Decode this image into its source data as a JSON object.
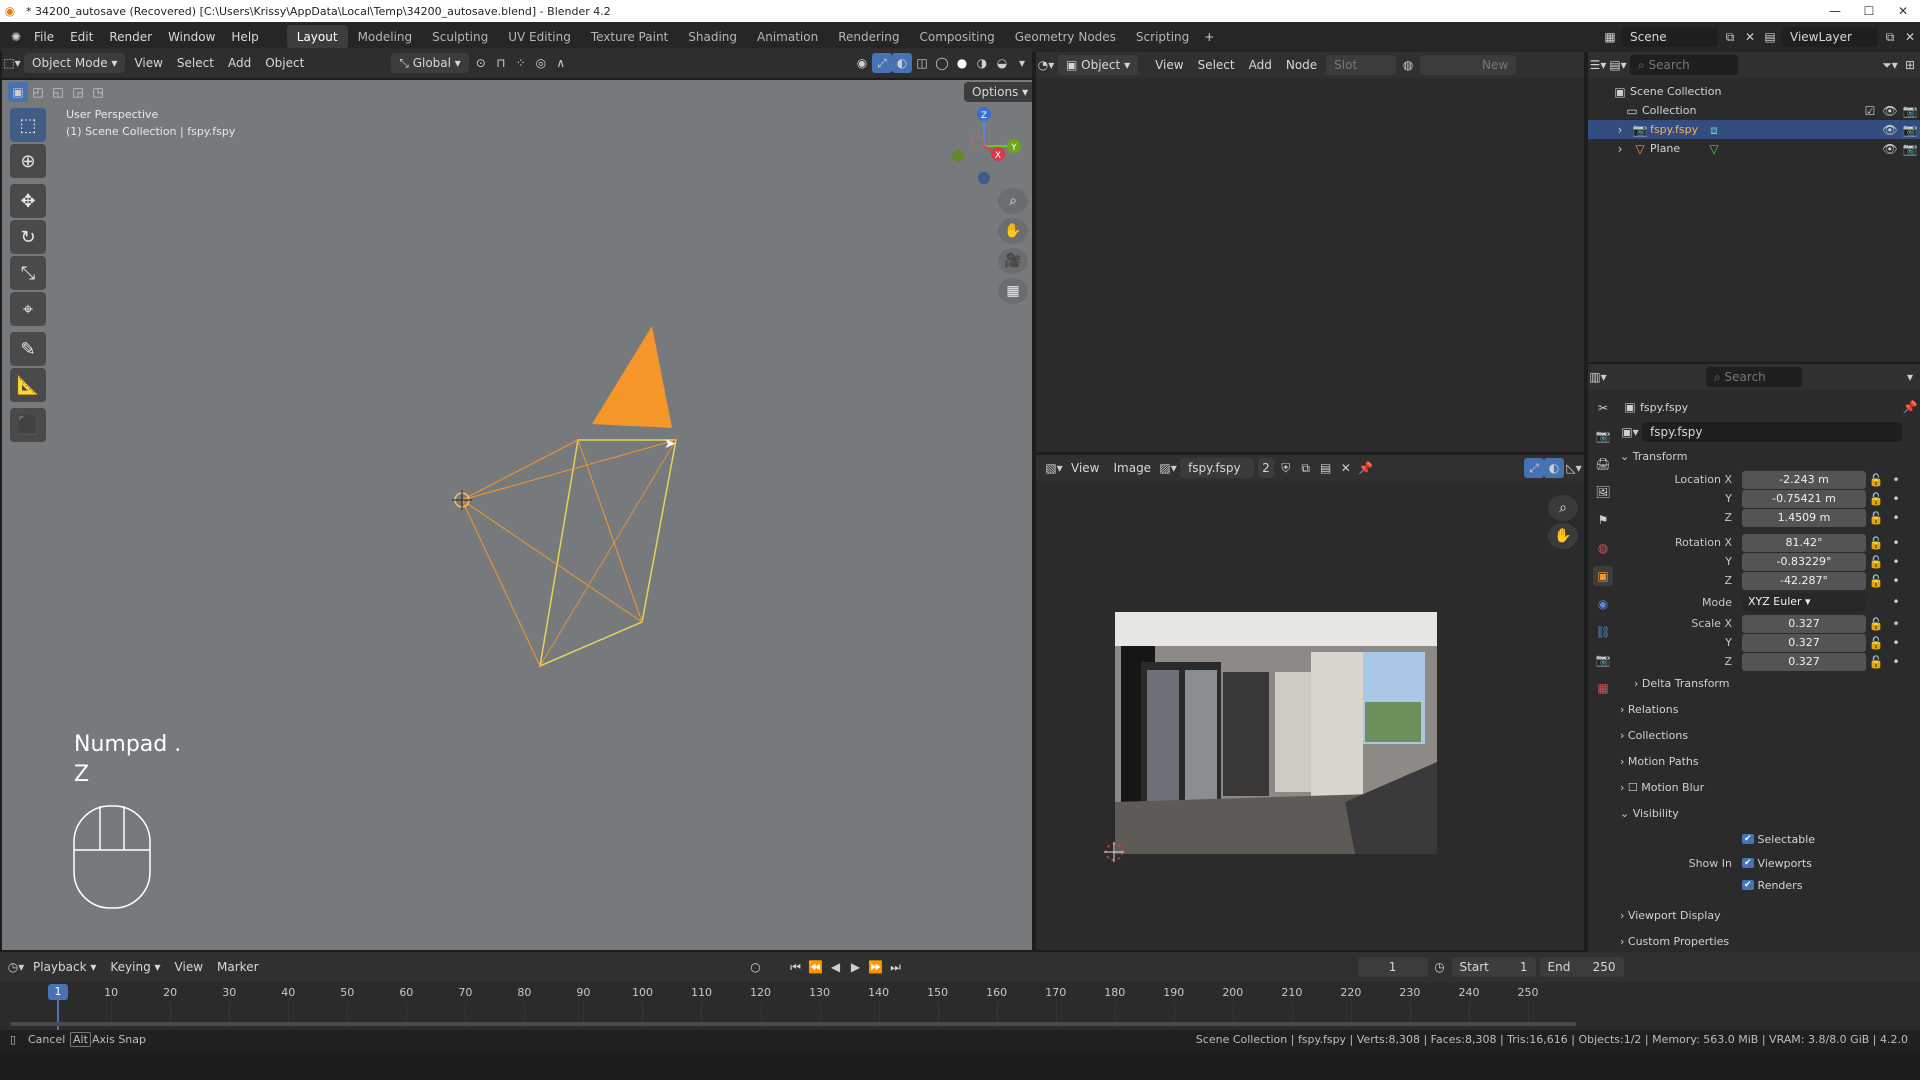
{
  "window_title": "* 34200_autosave (Recovered) [C:\\Users\\Krissy\\AppData\\Local\\Temp\\34200_autosave.blend] - Blender 4.2",
  "menu": [
    "File",
    "Edit",
    "Render",
    "Window",
    "Help"
  ],
  "workspaces": [
    "Layout",
    "Modeling",
    "Sculpting",
    "UV Editing",
    "Texture Paint",
    "Shading",
    "Animation",
    "Rendering",
    "Compositing",
    "Geometry Nodes",
    "Scripting"
  ],
  "active_workspace": "Layout",
  "top_right": {
    "scene": "Scene",
    "viewlayer": "ViewLayer"
  },
  "viewport": {
    "mode": "Object Mode",
    "menus": [
      "View",
      "Select",
      "Add",
      "Object"
    ],
    "orientation": "Global",
    "options": "Options",
    "overlay_line1": "User Perspective",
    "overlay_line2": "(1) Scene Collection | fspy.fspy",
    "key_hint1": "Numpad .",
    "key_hint2": "Z",
    "gizmo": {
      "z": "Z",
      "y": "Y",
      "x": "X"
    }
  },
  "node_editor": {
    "type": "Object",
    "menus": [
      "View",
      "Select",
      "Add",
      "Node"
    ],
    "slot": "Slot",
    "new": "New"
  },
  "image_editor": {
    "menus": [
      "View",
      "Image"
    ],
    "image_name": "fspy.fspy",
    "users": "2"
  },
  "outliner": {
    "search": "Search",
    "root": "Scene Collection",
    "items": [
      {
        "label": "Collection"
      },
      {
        "label": "fspy.fspy"
      },
      {
        "label": "Plane"
      }
    ]
  },
  "properties": {
    "search": "Search",
    "object_name": "fspy.fspy",
    "object_field": "fspy.fspy",
    "transform": "Transform",
    "location_label": "Location X",
    "location": {
      "x": "-2.243 m",
      "y": "-0.75421 m",
      "z": "1.4509 m"
    },
    "rotation_label": "Rotation X",
    "rotation": {
      "x": "81.42°",
      "y": "-0.83229°",
      "z": "-42.287°"
    },
    "mode_label": "Mode",
    "mode": "XYZ Euler",
    "scale_label": "Scale X",
    "scale": {
      "x": "0.327",
      "y": "0.327",
      "z": "0.327"
    },
    "y": "Y",
    "z": "Z",
    "sections": [
      "Delta Transform",
      "Relations",
      "Collections",
      "Motion Paths",
      "Motion Blur"
    ],
    "visibility": "Visibility",
    "selectable": "Selectable",
    "show_in": "Show In",
    "viewports": "Viewports",
    "renders": "Renders",
    "sections2": [
      "Viewport Display",
      "Custom Properties"
    ]
  },
  "timeline": {
    "menus": [
      "Playback",
      "Keying",
      "View",
      "Marker"
    ],
    "current_frame": "1",
    "start_label": "Start",
    "start": "1",
    "end_label": "End",
    "end": "250",
    "ticks": [
      "1",
      "10",
      "20",
      "30",
      "40",
      "50",
      "60",
      "70",
      "80",
      "90",
      "100",
      "110",
      "120",
      "130",
      "140",
      "150",
      "160",
      "170",
      "180",
      "190",
      "200",
      "210",
      "220",
      "230",
      "240",
      "250"
    ]
  },
  "status": {
    "cancel": "Cancel",
    "alt": "Alt",
    "axis_snap": "Axis Snap",
    "info": "Scene Collection | fspy.fspy | Verts:8,308 | Faces:8,308 | Tris:16,616 | Objects:1/2 | Memory: 563.0 MiB | VRAM: 3.8/8.0 GiB | 4.2.0"
  },
  "colors": {
    "accent": "#4772b3",
    "selected_orange": "#f5962a",
    "camera_yellow": "#e6d25a"
  }
}
